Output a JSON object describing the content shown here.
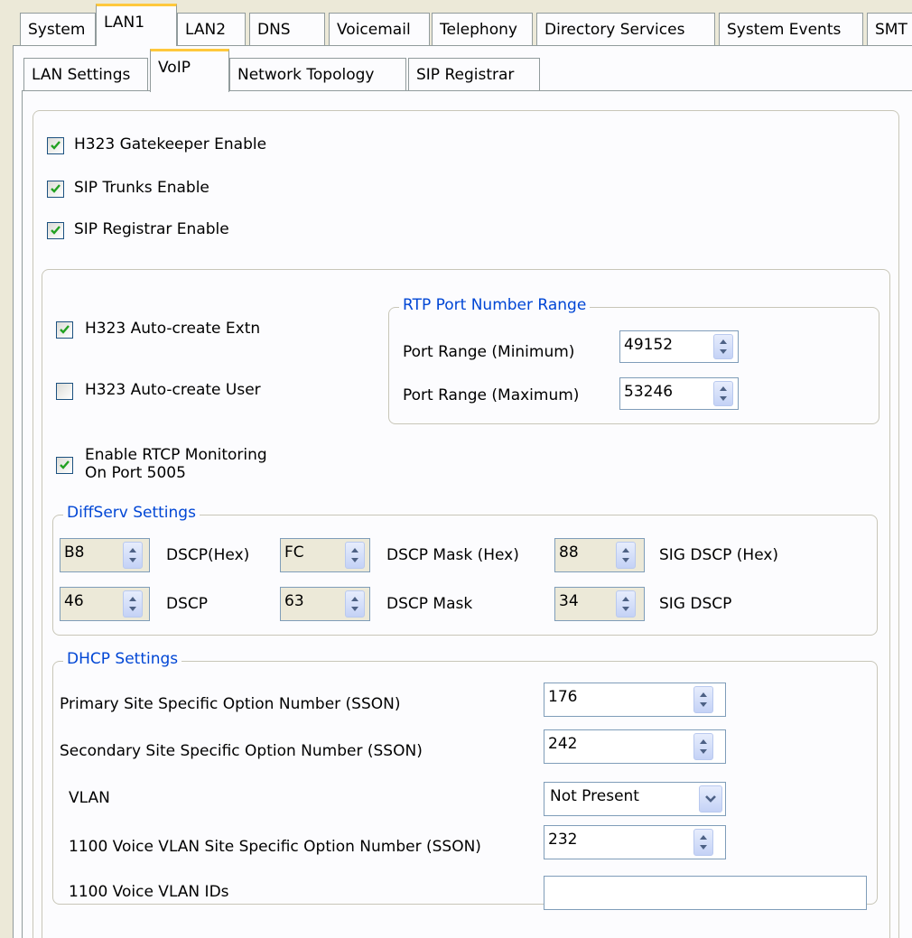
{
  "tabs_top": [
    "System",
    "LAN1",
    "LAN2",
    "DNS",
    "Voicemail",
    "Telephony",
    "Directory Services",
    "System Events",
    "SMT"
  ],
  "tabs_sub": [
    "LAN Settings",
    "VoIP",
    "Network Topology",
    "SIP Registrar"
  ],
  "checkboxes": {
    "h323_gatekeeper": {
      "label": "H323 Gatekeeper Enable",
      "checked": true
    },
    "sip_trunks": {
      "label": "SIP Trunks Enable",
      "checked": true
    },
    "sip_registrar": {
      "label": "SIP Registrar Enable",
      "checked": true
    },
    "h323_auto_extn": {
      "label": "H323 Auto-create Extn",
      "checked": true
    },
    "h323_auto_user": {
      "label": "H323 Auto-create User",
      "checked": false
    },
    "rtcp_line1": "Enable RTCP Monitoring",
    "rtcp_line2": "On Port 5005"
  },
  "rtp": {
    "title": "RTP Port Number Range",
    "min_label": "Port Range (Minimum)",
    "min_value": "49152",
    "max_label": "Port Range (Maximum)",
    "max_value": "53246"
  },
  "diffserv": {
    "title": "DiffServ Settings",
    "dscp_hex": "B8",
    "dscp_hex_label": "DSCP(Hex)",
    "mask_hex": "FC",
    "mask_hex_label": "DSCP Mask (Hex)",
    "sig_hex": "88",
    "sig_hex_label": "SIG DSCP (Hex)",
    "dscp": "46",
    "dscp_label": "DSCP",
    "mask": "63",
    "mask_label": "DSCP Mask",
    "sig": "34",
    "sig_label": "SIG DSCP"
  },
  "dhcp": {
    "title": "DHCP Settings",
    "primary_label": "Primary Site Specific Option Number (SSON)",
    "primary_value": "176",
    "secondary_label": "Secondary Site Specific Option Number (SSON)",
    "secondary_value": "242",
    "vlan_label": "VLAN",
    "vlan_value": "Not Present",
    "voice_sson_label": "1100 Voice VLAN Site Specific Option Number (SSON)",
    "voice_sson_value": "232",
    "voice_ids_label": "1100 Voice VLAN IDs",
    "voice_ids_value": ""
  }
}
